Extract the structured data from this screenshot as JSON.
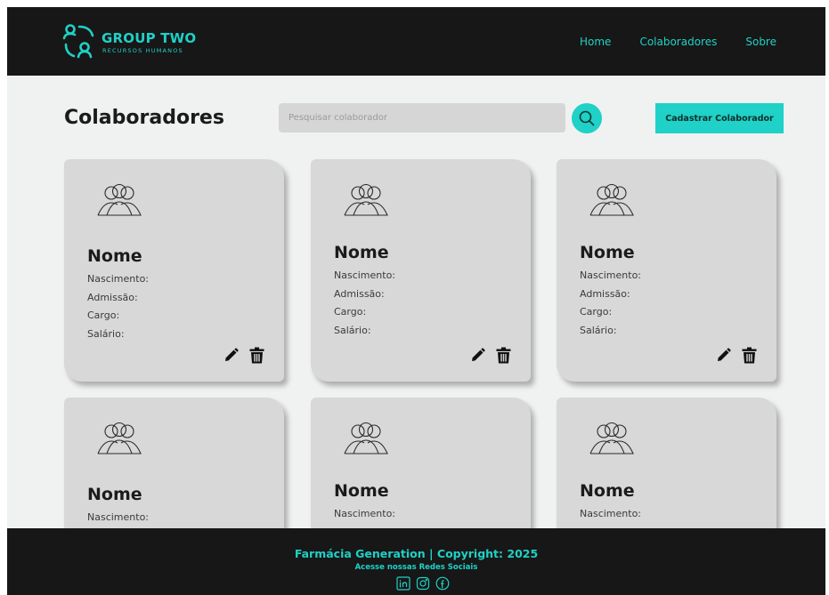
{
  "colors": {
    "accent": "#1fd1c6",
    "dark": "#171717",
    "card": "#d8d8d8",
    "background": "#f0f1f1"
  },
  "header": {
    "logo_title": "GROUP TWO",
    "logo_subtitle": "RECURSOS HUMANOS",
    "logo_icon": "users-icon",
    "nav": [
      {
        "label": "Home"
      },
      {
        "label": "Colaboradores"
      },
      {
        "label": "Sobre"
      }
    ]
  },
  "main": {
    "title": "Colaboradores",
    "search": {
      "placeholder": "Pesquisar colaborador",
      "value": "",
      "icon": "search-icon"
    },
    "add_button": "Cadastrar Colaborador",
    "cards": [
      {
        "name": "Nome",
        "fields": [
          "Nascimento:",
          "Admissão:",
          "Cargo:",
          "Salário:"
        ],
        "icons": [
          "users-icon",
          "pencil-icon",
          "trash-icon"
        ]
      },
      {
        "name": "Nome",
        "fields": [
          "Nascimento:",
          "Admissão:",
          "Cargo:",
          "Salário:"
        ],
        "icons": [
          "users-icon",
          "pencil-icon",
          "trash-icon"
        ]
      },
      {
        "name": "Nome",
        "fields": [
          "Nascimento:",
          "Admissão:",
          "Cargo:",
          "Salário:"
        ],
        "icons": [
          "users-icon",
          "pencil-icon",
          "trash-icon"
        ]
      },
      {
        "name": "Nome",
        "fields": [
          "Nascimento:"
        ],
        "icons": [
          "users-icon"
        ]
      },
      {
        "name": "Nome",
        "fields": [
          "Nascimento:"
        ],
        "icons": [
          "users-icon"
        ]
      },
      {
        "name": "Nome",
        "fields": [
          "Nascimento:"
        ],
        "icons": [
          "users-icon"
        ]
      }
    ]
  },
  "footer": {
    "title": "Farmácia Generation | Copyright: 2025",
    "subtitle": "Acesse nossas Redes Sociais",
    "socials": [
      "linkedin-icon",
      "instagram-icon",
      "facebook-icon"
    ]
  }
}
